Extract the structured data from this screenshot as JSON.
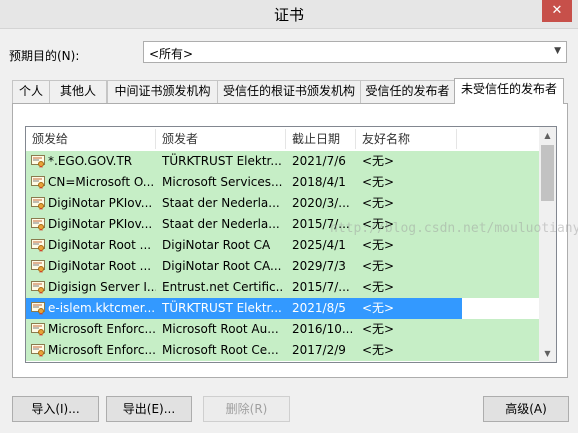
{
  "window": {
    "title": "证书",
    "close_glyph": "✕"
  },
  "purpose": {
    "label": "预期目的(N):",
    "value": "<所有>"
  },
  "tabs": [
    {
      "label": "个人"
    },
    {
      "label": "其他人"
    },
    {
      "label": "中间证书颁发机构"
    },
    {
      "label": "受信任的根证书颁发机构"
    },
    {
      "label": "受信任的发布者"
    },
    {
      "label": "未受信任的发布者"
    }
  ],
  "active_tab": "未受信任的发布者",
  "list": {
    "columns": [
      "颁发给",
      "颁发者",
      "截止日期",
      "友好名称"
    ],
    "rows": [
      {
        "issued_to": "*.EGO.GOV.TR",
        "issuer": "TÜRKTRUST Elektr...",
        "expires": "2021/7/6",
        "friendly": "<无>"
      },
      {
        "issued_to": "CN=Microsoft O...",
        "issuer": "Microsoft Services...",
        "expires": "2018/4/1",
        "friendly": "<无>"
      },
      {
        "issued_to": "DigiNotar PKIov...",
        "issuer": "Staat der Nederla...",
        "expires": "2020/3/...",
        "friendly": "<无>"
      },
      {
        "issued_to": "DigiNotar PKIov...",
        "issuer": "Staat der Nederla...",
        "expires": "2015/7/...",
        "friendly": "<无>"
      },
      {
        "issued_to": "DigiNotar Root ...",
        "issuer": "DigiNotar Root CA",
        "expires": "2025/4/1",
        "friendly": "<无>"
      },
      {
        "issued_to": "DigiNotar Root ...",
        "issuer": "DigiNotar Root CA...",
        "expires": "2029/7/3",
        "friendly": "<无>"
      },
      {
        "issued_to": "Digisign Server I...",
        "issuer": "Entrust.net Certific...",
        "expires": "2015/7/...",
        "friendly": "<无>"
      },
      {
        "issued_to": "e-islem.kktcmer...",
        "issuer": "TÜRKTRUST Elektr...",
        "expires": "2021/8/5",
        "friendly": "<无>"
      },
      {
        "issued_to": "Microsoft Enforc...",
        "issuer": "Microsoft Root Au...",
        "expires": "2016/10...",
        "friendly": "<无>"
      },
      {
        "issued_to": "Microsoft Enforc...",
        "issuer": "Microsoft Root Ce...",
        "expires": "2017/2/9",
        "friendly": "<无>"
      }
    ],
    "selected_row": 7
  },
  "buttons": {
    "import": "导入(I)...",
    "export": "导出(E)...",
    "remove": "删除(R)",
    "advanced": "高级(A)"
  },
  "watermark": "http://blog.csdn.net/mouluotianya",
  "colors": {
    "row_green": "#c6eec6",
    "selection": "#3399ff",
    "close": "#c7504a"
  }
}
